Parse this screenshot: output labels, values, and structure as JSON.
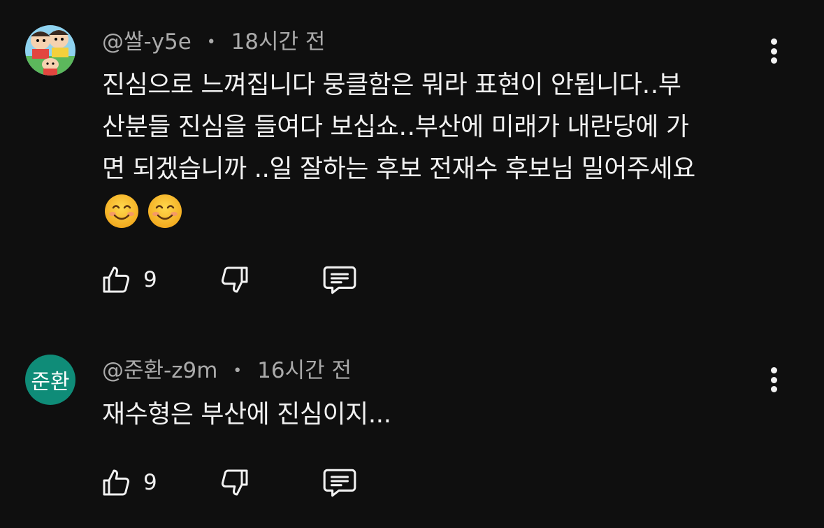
{
  "comments": [
    {
      "handle": "@쌀-y5e",
      "time": "18시간 전",
      "text": "진심으로 느껴집니다 뭉클함은 뭐라 표현이 안됩니다‥부\n산분들 진심을 들여다 보십쇼‥부산에 미래가 내란당에 가\n면 되겠습니까 ..일 잘하는 후보 전재수 후보님 밀어주세요",
      "emojis": [
        "😊",
        "😊"
      ],
      "likes": "9",
      "avatar": {
        "type": "image",
        "icon": "cartoon-avatar-icon"
      }
    },
    {
      "handle": "@준환-z9m",
      "time": "16시간 전",
      "text": "재수형은 부산에 진심이지...",
      "likes": "9",
      "avatar": {
        "type": "text",
        "text": "준환",
        "color": "#0f8c78"
      }
    }
  ],
  "colors": {
    "background": "#0f0f0f",
    "text": "#f1f1f1",
    "meta": "#aaaaaa"
  }
}
